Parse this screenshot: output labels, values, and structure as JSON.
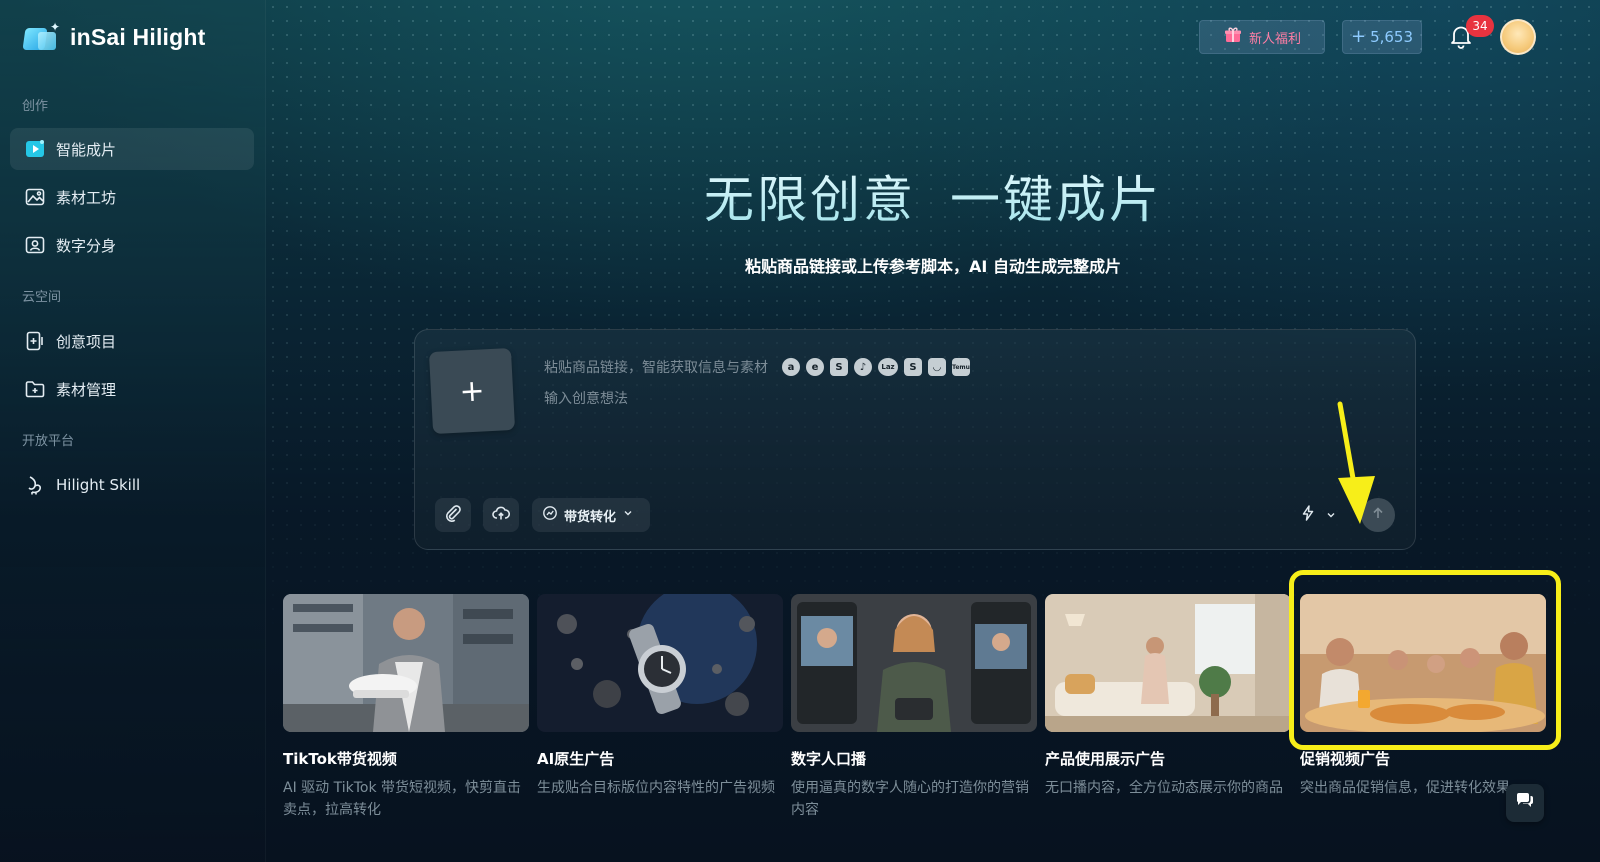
{
  "app": {
    "logo_text": "inSai Hilight"
  },
  "sidebar": {
    "sections": [
      {
        "label": "创作"
      },
      {
        "label": "云空间"
      },
      {
        "label": "开放平台"
      }
    ],
    "items": [
      {
        "label": "智能成片",
        "icon": "smart-video-icon",
        "active": true
      },
      {
        "label": "素材工坊",
        "icon": "image-workshop-icon",
        "active": false
      },
      {
        "label": "数字分身",
        "icon": "digital-avatar-icon",
        "active": false
      },
      {
        "label": "创意项目",
        "icon": "creative-project-icon",
        "active": false
      },
      {
        "label": "素材管理",
        "icon": "folder-icon",
        "active": false
      },
      {
        "label": "Hilight Skill",
        "icon": "skill-icon",
        "active": false
      }
    ]
  },
  "header": {
    "welfare_label": "新人福利",
    "points_label": "5,653",
    "notifications_count": "34"
  },
  "hero": {
    "title_part1": "无限创意",
    "title_part2": "一键成片",
    "subtitle": "粘贴商品链接或上传参考脚本，AI 自动生成完整成片"
  },
  "composer": {
    "upload_glyph": "+",
    "link_placeholder": "粘贴商品链接，智能获取信息与素材",
    "platform_icons": [
      {
        "name": "amazon-icon",
        "glyph": "a"
      },
      {
        "name": "ebay-icon",
        "glyph": "e"
      },
      {
        "name": "shopee-icon",
        "glyph": "S"
      },
      {
        "name": "tiktok-icon",
        "glyph": "♪"
      },
      {
        "name": "lazada-icon",
        "glyph": "Laz"
      },
      {
        "name": "shopify-icon",
        "glyph": "S"
      },
      {
        "name": "shop-icon",
        "glyph": "◡"
      },
      {
        "name": "temu-icon",
        "glyph": "Temu"
      }
    ],
    "idea_placeholder": "输入创意想法",
    "mode_label": "带货转化"
  },
  "cards": [
    {
      "title": "TikTok带货视频",
      "desc": "AI 驱动 TikTok 带货短视频，快剪直击卖点，拉高转化"
    },
    {
      "title": "AI原生广告",
      "desc": "生成贴合目标版位内容特性的广告视频"
    },
    {
      "title": "数字人口播",
      "desc": "使用逼真的数字人随心的打造你的营销内容"
    },
    {
      "title": "产品使用展示广告",
      "desc": "无口播内容，全方位动态展示你的商品"
    },
    {
      "title": "促销视频广告",
      "desc": "突出商品促销信息，促进转化效果"
    }
  ],
  "colors": {
    "accent": "#22d3ee",
    "highlight": "#f7ee19",
    "badge": "#e8333f"
  }
}
